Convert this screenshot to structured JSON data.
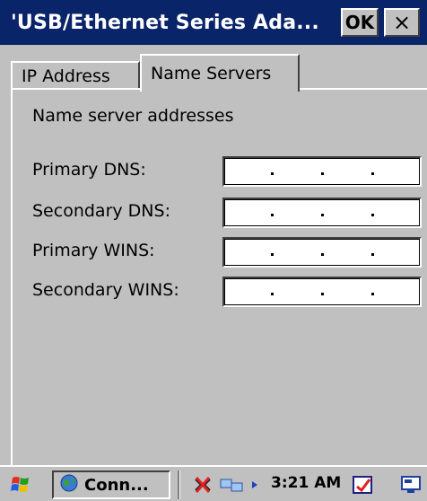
{
  "window": {
    "title": "'USB/Ethernet Series Ada...",
    "ok_label": "OK",
    "close_label": "×"
  },
  "tabs": [
    {
      "label": "IP Address",
      "active": false
    },
    {
      "label": "Name Servers",
      "active": true
    }
  ],
  "section": {
    "heading": "Name server addresses"
  },
  "fields": [
    {
      "label": "Primary DNS:",
      "value": ""
    },
    {
      "label": "Secondary DNS:",
      "value": ""
    },
    {
      "label": "Primary WINS:",
      "value": ""
    },
    {
      "label": "Secondary WINS:",
      "value": ""
    }
  ],
  "taskbar": {
    "task_label": "Conn...",
    "clock": "3:21 AM"
  },
  "icons": {
    "start": "windows-flag-icon",
    "task": "network-globe-icon",
    "tray": [
      "network-disconnected-icon",
      "network-computers-icon",
      "arrow-right-icon",
      "sip-input-icon",
      "desktop-toggle-icon"
    ]
  },
  "colors": {
    "titlebar": "#0a246a",
    "surface": "#c0c0c0"
  }
}
